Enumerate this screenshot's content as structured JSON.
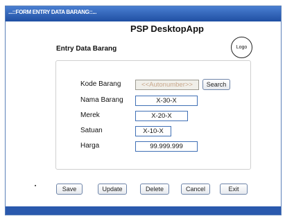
{
  "window": {
    "title": "...::FORM ENTRY DATA BARANG::..."
  },
  "header": {
    "app_title": "PSP DesktopApp",
    "section_title": "Entry Data Barang",
    "logo_label": "Logo"
  },
  "form": {
    "fields": [
      {
        "label": "Kode Barang",
        "value": "<<Autonumber>>"
      },
      {
        "label": "Nama Barang",
        "value": "X-30-X"
      },
      {
        "label": "Merek",
        "value": "X-20-X"
      },
      {
        "label": "Satuan",
        "value": "X-10-X"
      },
      {
        "label": "Harga",
        "value": "99.999.999"
      }
    ],
    "search_label": "Search"
  },
  "actions": {
    "save": "Save",
    "update": "Update",
    "delete": "Delete",
    "cancel": "Cancel",
    "exit": "Exit"
  },
  "colors": {
    "titlebar": "#2f63b8",
    "field_border": "#3f6fb5",
    "autonumber_text": "#c9a88c"
  }
}
